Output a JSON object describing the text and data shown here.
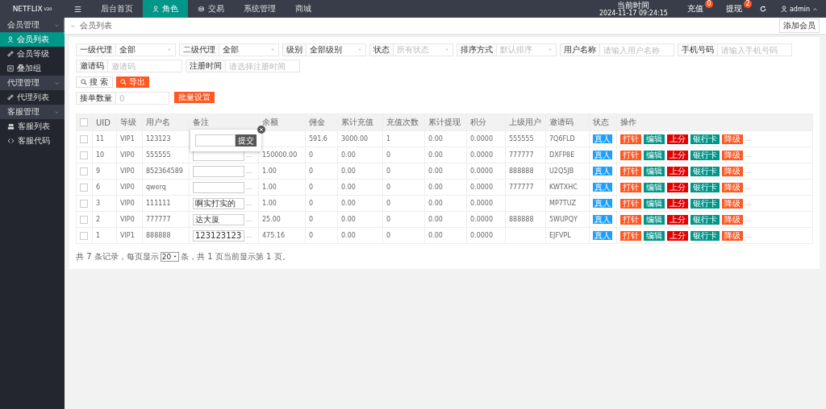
{
  "topbar": {
    "logo": "NETFLIX",
    "logo_version": "V20",
    "nav": [
      {
        "label": "☰",
        "kind": "plain",
        "selected": false
      },
      {
        "label": "后台首页",
        "kind": "plain",
        "selected": false
      },
      {
        "label": "角色",
        "kind": "user",
        "selected": true
      },
      {
        "label": "交易",
        "kind": "money",
        "selected": false
      },
      {
        "label": "系统管理",
        "kind": "plain",
        "selected": false
      },
      {
        "label": "商城",
        "kind": "plain",
        "selected": false
      }
    ],
    "clock_label": "当前时间",
    "clock": "2024-11-17 09:24:15",
    "links": [
      {
        "label": "充值",
        "badge": "0"
      },
      {
        "label": "提现",
        "badge": "2"
      }
    ],
    "user": "admin"
  },
  "sidebar": [
    {
      "label": "会员管理",
      "expanded": true,
      "children": [
        {
          "label": "会员列表",
          "kind": "user",
          "selected": true
        },
        {
          "label": "会员等级",
          "kind": "link",
          "selected": false
        },
        {
          "label": "叠加组",
          "kind": "grid",
          "selected": false
        }
      ]
    },
    {
      "label": "代理管理",
      "expanded": true,
      "children": [
        {
          "label": "代理列表",
          "kind": "link",
          "selected": false
        }
      ]
    },
    {
      "label": "客服管理",
      "expanded": true,
      "children": [
        {
          "label": "客服列表",
          "kind": "group",
          "selected": false
        },
        {
          "label": "客服代码",
          "kind": "code",
          "selected": false
        }
      ]
    }
  ],
  "breadcrumb": "会员列表",
  "add_button": "添加会员",
  "filters": [
    {
      "label": "一级代理",
      "kind": "select",
      "value": "全部"
    },
    {
      "label": "二级代理",
      "kind": "select",
      "value": "全部"
    },
    {
      "label": "级别",
      "kind": "select",
      "value": "全部级别"
    },
    {
      "label": "状态",
      "kind": "select",
      "placeholder": "所有状态"
    },
    {
      "label": "排序方式",
      "kind": "select",
      "placeholder": "默认排序"
    },
    {
      "label": "用户名称",
      "kind": "input",
      "placeholder": "请输入用户名称"
    },
    {
      "label": "手机号码",
      "kind": "input",
      "placeholder": "请输入手机号码"
    },
    {
      "label": "邀请码",
      "kind": "input",
      "placeholder": "邀请码"
    },
    {
      "label": "注册时间",
      "kind": "input",
      "placeholder": "请选择注册时间"
    }
  ],
  "search_button": "搜 索",
  "export_button": "导出",
  "batch": {
    "label": "接单数量",
    "placeholder": "0",
    "button": "批量设置"
  },
  "table": {
    "columns": [
      "UID",
      "等级",
      "用户名",
      "备注",
      "余额",
      "佣金",
      "累计充值",
      "充值次数",
      "累计提现",
      "积分",
      "上级用户",
      "邀请码",
      "状态",
      "操作"
    ],
    "header_checked": false,
    "rows": [
      {
        "checked": false,
        "uid": "11",
        "level": "VIP1",
        "username": "123123",
        "commission": "591.6",
        "total_recharge": "3000.00",
        "recharge_count": "1",
        "total_withdraw": "0.00",
        "points": "0.0000",
        "parent": "555555",
        "invite": "7Q6FLD",
        "status": "真人",
        "actions": [
          {
            "label": "打针",
            "kind": "warm"
          },
          {
            "label": "编辑",
            "kind": "normal"
          },
          {
            "label": "上分",
            "kind": "danger"
          },
          {
            "label": "银行卡",
            "kind": "normal"
          },
          {
            "label": "降级",
            "kind": "warm"
          }
        ],
        "more": "..."
      },
      {
        "checked": false,
        "uid": "10",
        "level": "VIP0",
        "username": "555555",
        "remark": "",
        "remark_more": "...",
        "balance": "150000.00",
        "commission": "0",
        "total_recharge": "0.00",
        "recharge_count": "0",
        "total_withdraw": "0.00",
        "points": "0.0000",
        "parent": "777777",
        "invite": "DXFP8E",
        "status": "真人",
        "actions": [
          {
            "label": "打针",
            "kind": "warm"
          },
          {
            "label": "编辑",
            "kind": "normal"
          },
          {
            "label": "上分",
            "kind": "danger"
          },
          {
            "label": "银行卡",
            "kind": "normal"
          },
          {
            "label": "降级",
            "kind": "warm"
          }
        ],
        "more": "..."
      },
      {
        "checked": false,
        "uid": "9",
        "level": "VIP0",
        "username": "852364589",
        "remark": "",
        "remark_more": "...",
        "balance": "1.00",
        "commission": "0",
        "total_recharge": "0.00",
        "recharge_count": "0",
        "total_withdraw": "0.00",
        "points": "0.0000",
        "parent": "888888",
        "invite": "U2Q5JB",
        "status": "真人",
        "actions": [
          {
            "label": "打针",
            "kind": "warm"
          },
          {
            "label": "编辑",
            "kind": "normal"
          },
          {
            "label": "上分",
            "kind": "danger"
          },
          {
            "label": "银行卡",
            "kind": "normal"
          },
          {
            "label": "降级",
            "kind": "warm"
          }
        ],
        "more": "..."
      },
      {
        "checked": false,
        "uid": "6",
        "level": "VIP0",
        "username": "qwerq",
        "remark": "",
        "remark_more": "...",
        "balance": "1.00",
        "commission": "0",
        "total_recharge": "0.00",
        "recharge_count": "0",
        "total_withdraw": "0.00",
        "points": "0.0000",
        "parent": "777777",
        "invite": "KWTXHC",
        "status": "真人",
        "actions": [
          {
            "label": "打针",
            "kind": "warm"
          },
          {
            "label": "编辑",
            "kind": "normal"
          },
          {
            "label": "上分",
            "kind": "danger"
          },
          {
            "label": "银行卡",
            "kind": "normal"
          },
          {
            "label": "降级",
            "kind": "warm"
          }
        ],
        "more": "..."
      },
      {
        "checked": false,
        "uid": "3",
        "level": "VIP0",
        "username": "111111",
        "remark": "啊实打实的",
        "remark_more": "...",
        "balance": "1.00",
        "commission": "0",
        "total_recharge": "0.00",
        "recharge_count": "0",
        "total_withdraw": "0.00",
        "points": "0.0000",
        "invite": "MP7TUZ",
        "status": "真人",
        "actions": [
          {
            "label": "打针",
            "kind": "warm"
          },
          {
            "label": "编辑",
            "kind": "normal"
          },
          {
            "label": "上分",
            "kind": "danger"
          },
          {
            "label": "银行卡",
            "kind": "normal"
          },
          {
            "label": "降级",
            "kind": "warm"
          }
        ],
        "more": "..."
      },
      {
        "checked": false,
        "uid": "2",
        "level": "VIP0",
        "username": "777777",
        "remark": "达大厦",
        "remark_more": "...",
        "balance": "25.00",
        "commission": "0",
        "total_recharge": "0.00",
        "recharge_count": "0",
        "total_withdraw": "0.00",
        "points": "0.0000",
        "parent": "888888",
        "invite": "5WUPQY",
        "status": "真人",
        "actions": [
          {
            "label": "打针",
            "kind": "warm"
          },
          {
            "label": "编辑",
            "kind": "normal"
          },
          {
            "label": "上分",
            "kind": "danger"
          },
          {
            "label": "银行卡",
            "kind": "normal"
          },
          {
            "label": "降级",
            "kind": "warm"
          }
        ],
        "more": "..."
      },
      {
        "checked": false,
        "uid": "1",
        "level": "VIP1",
        "username": "888888",
        "remark": "123123123",
        "remark_more": "...",
        "balance": "475.16",
        "commission": "0",
        "total_recharge": "0.00",
        "recharge_count": "0",
        "total_withdraw": "0.00",
        "points": "0.0000",
        "invite": "EJFVPL",
        "status": "真人",
        "actions": [
          {
            "label": "打针",
            "kind": "warm"
          },
          {
            "label": "编辑",
            "kind": "normal"
          },
          {
            "label": "上分",
            "kind": "danger"
          },
          {
            "label": "银行卡",
            "kind": "normal"
          },
          {
            "label": "降级",
            "kind": "warm"
          }
        ],
        "more": "..."
      }
    ]
  },
  "popup": {
    "button": "提交"
  },
  "pager": {
    "before": "共 7 条记录，每页显示",
    "page_size": "20",
    "after": "条，共 1 页当前显示第 1 页。"
  }
}
